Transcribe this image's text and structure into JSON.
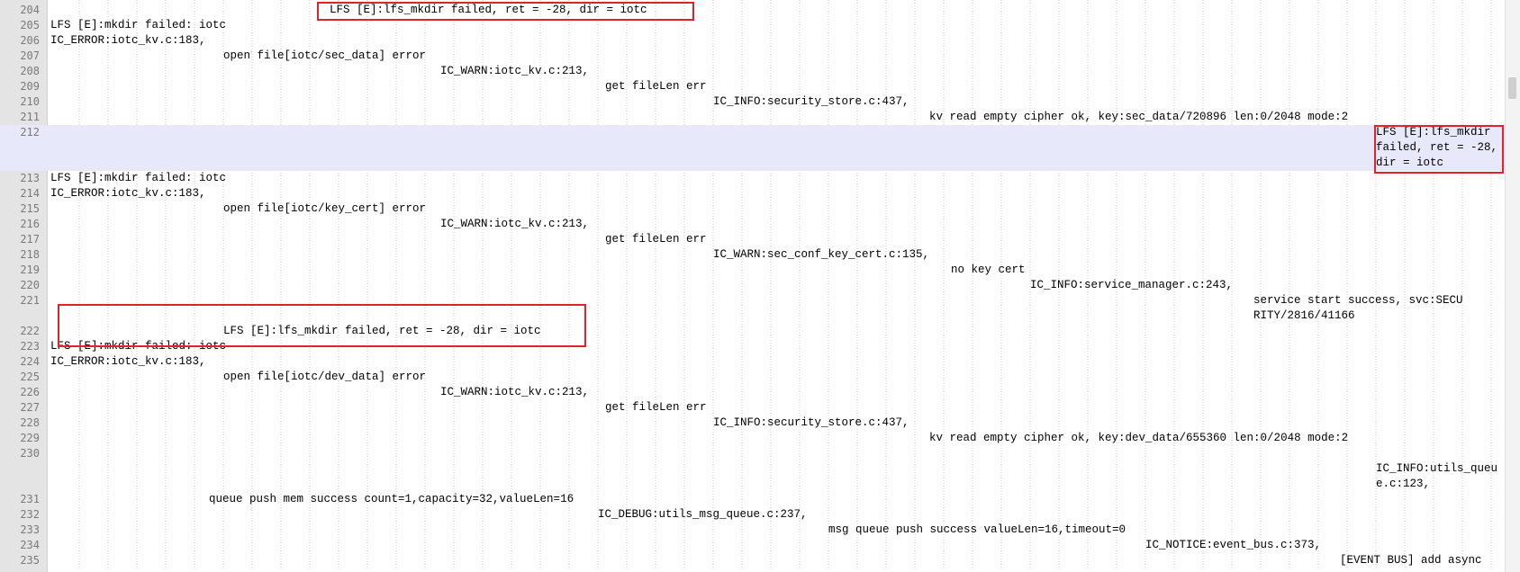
{
  "lines": [
    {
      "num": "204",
      "text": "LFS [E]:lfs_mkdir failed, ret = -28, dir = iotc"
    },
    {
      "num": "205",
      "text": "LFS [E]:mkdir failed: iotc"
    },
    {
      "num": "206",
      "text": "IC_ERROR:iotc_kv.c:183,"
    },
    {
      "num": "207",
      "text": "open file[iotc/sec_data] error"
    },
    {
      "num": "208",
      "text": "IC_WARN:iotc_kv.c:213,"
    },
    {
      "num": "209",
      "text": "get fileLen err"
    },
    {
      "num": "210",
      "text": "IC_INFO:security_store.c:437,"
    },
    {
      "num": "211",
      "text": "kv read empty cipher ok, key:sec_data/720896 len:0/2048 mode:2"
    },
    {
      "num": "212",
      "text": "LFS [E]:lfs_mkdir failed, ret = -28, dir = iotc"
    },
    {
      "num": "213",
      "text": "LFS [E]:mkdir failed: iotc"
    },
    {
      "num": "214",
      "text": "IC_ERROR:iotc_kv.c:183,"
    },
    {
      "num": "215",
      "text": "open file[iotc/key_cert] error"
    },
    {
      "num": "216",
      "text": "IC_WARN:iotc_kv.c:213,"
    },
    {
      "num": "217",
      "text": "get fileLen err"
    },
    {
      "num": "218",
      "text": "IC_WARN:sec_conf_key_cert.c:135,"
    },
    {
      "num": "219",
      "text": "no key cert"
    },
    {
      "num": "220",
      "text": "IC_INFO:service_manager.c:243,"
    },
    {
      "num": "221",
      "text": "service start success, svc:SECURITY/2816/41166"
    },
    {
      "num": "222",
      "text": "LFS [E]:lfs_mkdir failed, ret = -28, dir = iotc"
    },
    {
      "num": "223",
      "text": "LFS [E]:mkdir failed: iotc"
    },
    {
      "num": "224",
      "text": "IC_ERROR:iotc_kv.c:183,"
    },
    {
      "num": "225",
      "text": "open file[iotc/dev_data] error"
    },
    {
      "num": "226",
      "text": "IC_WARN:iotc_kv.c:213,"
    },
    {
      "num": "227",
      "text": "get fileLen err"
    },
    {
      "num": "228",
      "text": "IC_INFO:security_store.c:437,"
    },
    {
      "num": "229",
      "text": "kv read empty cipher ok, key:dev_data/655360 len:0/2048 mode:2"
    },
    {
      "num": "230",
      "text": "IC_INFO:utils_queue.c:123,"
    },
    {
      "num": "231",
      "text": "queue push mem success count=1,capacity=32,valueLen=16"
    },
    {
      "num": "232",
      "text": "IC_DEBUG:utils_msg_queue.c:237,"
    },
    {
      "num": "233",
      "text": "msg queue push success valueLen=16,timeout=0"
    },
    {
      "num": "234",
      "text": "IC_NOTICE:event_bus.c:373,"
    },
    {
      "num": "235",
      "text": "[EVENT BUS] add async"
    }
  ],
  "colors": {
    "highlight": "#e8e8fb",
    "annotation_box": "#e3212b",
    "gutter": "#e4e4e4"
  }
}
